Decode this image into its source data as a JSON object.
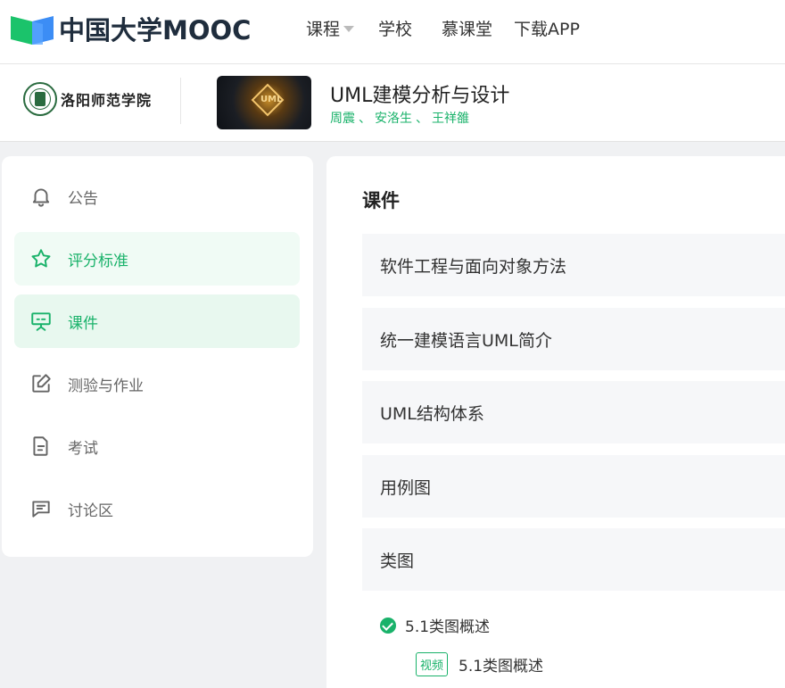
{
  "brand": {
    "logo_text": "中国大学MOOC"
  },
  "nav": {
    "items": [
      {
        "label": "课程"
      },
      {
        "label": "学校"
      },
      {
        "label": "慕课堂"
      },
      {
        "label": "下载APP"
      }
    ]
  },
  "course": {
    "school": "洛阳师范学院",
    "title": "UML建模分析与设计",
    "cover_text": "UML",
    "teachers": [
      "周震",
      "安洛生",
      "王祥雒"
    ],
    "separator": "、"
  },
  "sidebar": {
    "items": [
      {
        "label": "公告",
        "icon": "bell-icon"
      },
      {
        "label": "评分标准",
        "icon": "star-icon"
      },
      {
        "label": "课件",
        "icon": "presentation-icon"
      },
      {
        "label": "测验与作业",
        "icon": "edit-icon"
      },
      {
        "label": "考试",
        "icon": "document-icon"
      },
      {
        "label": "讨论区",
        "icon": "chat-icon"
      }
    ]
  },
  "main": {
    "title": "课件",
    "chapters": [
      {
        "label": "软件工程与面向对象方法"
      },
      {
        "label": "统一建模语言UML简介"
      },
      {
        "label": "UML结构体系"
      },
      {
        "label": "用例图"
      },
      {
        "label": "类图"
      }
    ],
    "lesson": {
      "label": "5.1类图概述"
    },
    "unit": {
      "tag": "视频",
      "label": "5.1类图概述"
    }
  },
  "colors": {
    "accent": "#19b26a",
    "brand_green": "#1bc36b",
    "brand_blue": "#3c8df5"
  }
}
